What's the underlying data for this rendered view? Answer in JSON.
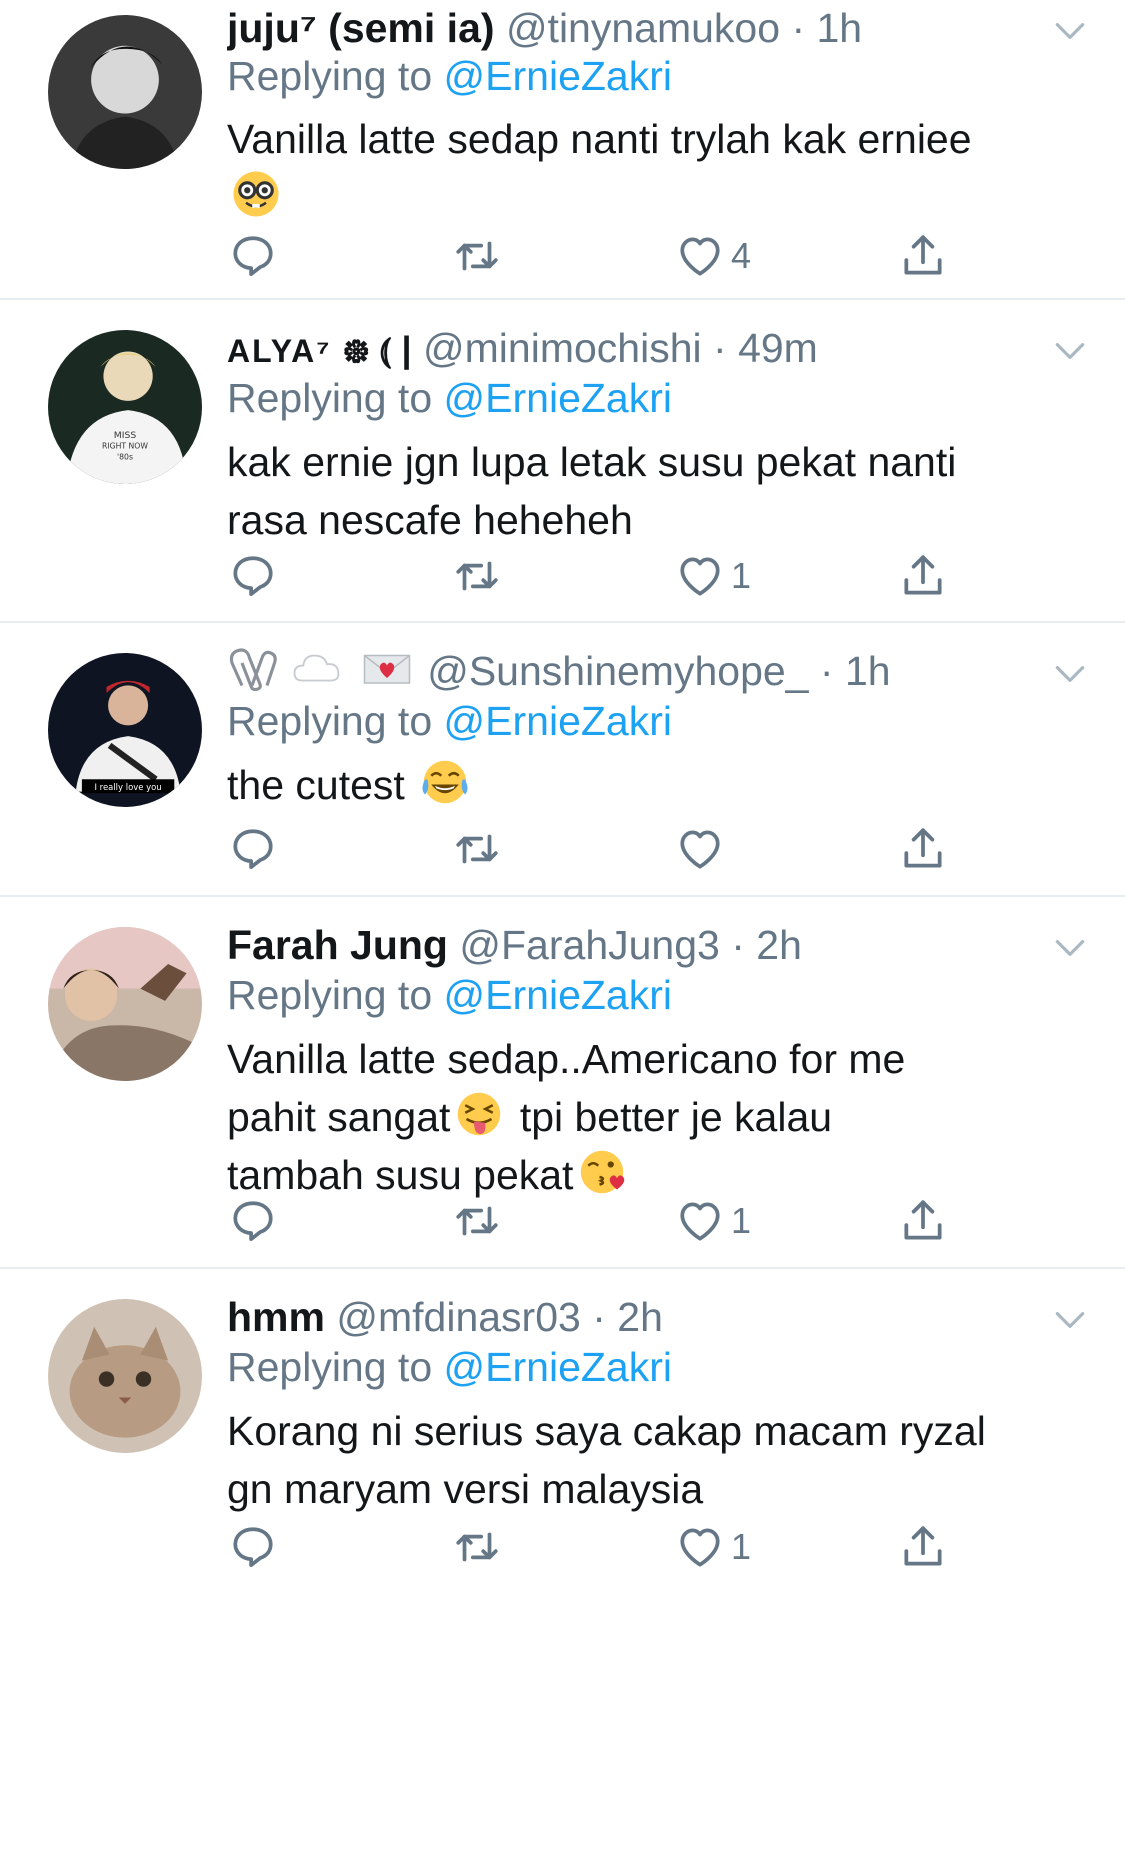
{
  "tweets": [
    {
      "name": "juju⁷ (semi ia)",
      "handle": "@tinynamukoo",
      "time": "1h",
      "replying_prefix": "Replying to",
      "replying_to": "@ErnieZakri",
      "text_lines": [
        "Vanilla latte sedap nanti trylah kak erniee"
      ],
      "emoji": "nerd-face",
      "likes": "4"
    },
    {
      "name": "ALYA⁷",
      "name_suffix": "᪥ ⦅ |",
      "handle": "@minimochishi",
      "time": "49m",
      "replying_prefix": "Replying to",
      "replying_to": "@ErnieZakri",
      "text_lines": [
        "kak ernie jgn lupa letak susu pekat nanti",
        "rasa nescafe heheheh"
      ],
      "likes": "1"
    },
    {
      "name_emojis": [
        "paperclip-icon",
        "cloud-icon",
        "love-letter-icon"
      ],
      "handle": "@Sunshinemyhope_",
      "time": "1h",
      "replying_prefix": "Replying to",
      "replying_to": "@ErnieZakri",
      "text_lines": [
        "the cutest"
      ],
      "emoji": "tears-of-joy",
      "avatar_caption": "I really love you",
      "likes": ""
    },
    {
      "name": "Farah Jung",
      "handle": "@FarahJung3",
      "time": "2h",
      "replying_prefix": "Replying to",
      "replying_to": "@ErnieZakri",
      "text_lines": [
        "Vanilla latte sedap..Americano for me",
        "pahit sangat",
        "tpi better je kalau",
        "tambah susu pekat"
      ],
      "likes": "1"
    },
    {
      "name": "hmm",
      "handle": "@mfdinasr03",
      "time": "2h",
      "replying_prefix": "Replying to",
      "replying_to": "@ErnieZakri",
      "text_lines": [
        "Korang ni serius saya cakap macam ryzal",
        "gn maryam versi malaysia"
      ],
      "likes": "1"
    }
  ],
  "colors": {
    "link": "#1da1f2",
    "muted": "#657786",
    "text": "#14171a",
    "divider": "#e6ecf0"
  },
  "dot": "·"
}
